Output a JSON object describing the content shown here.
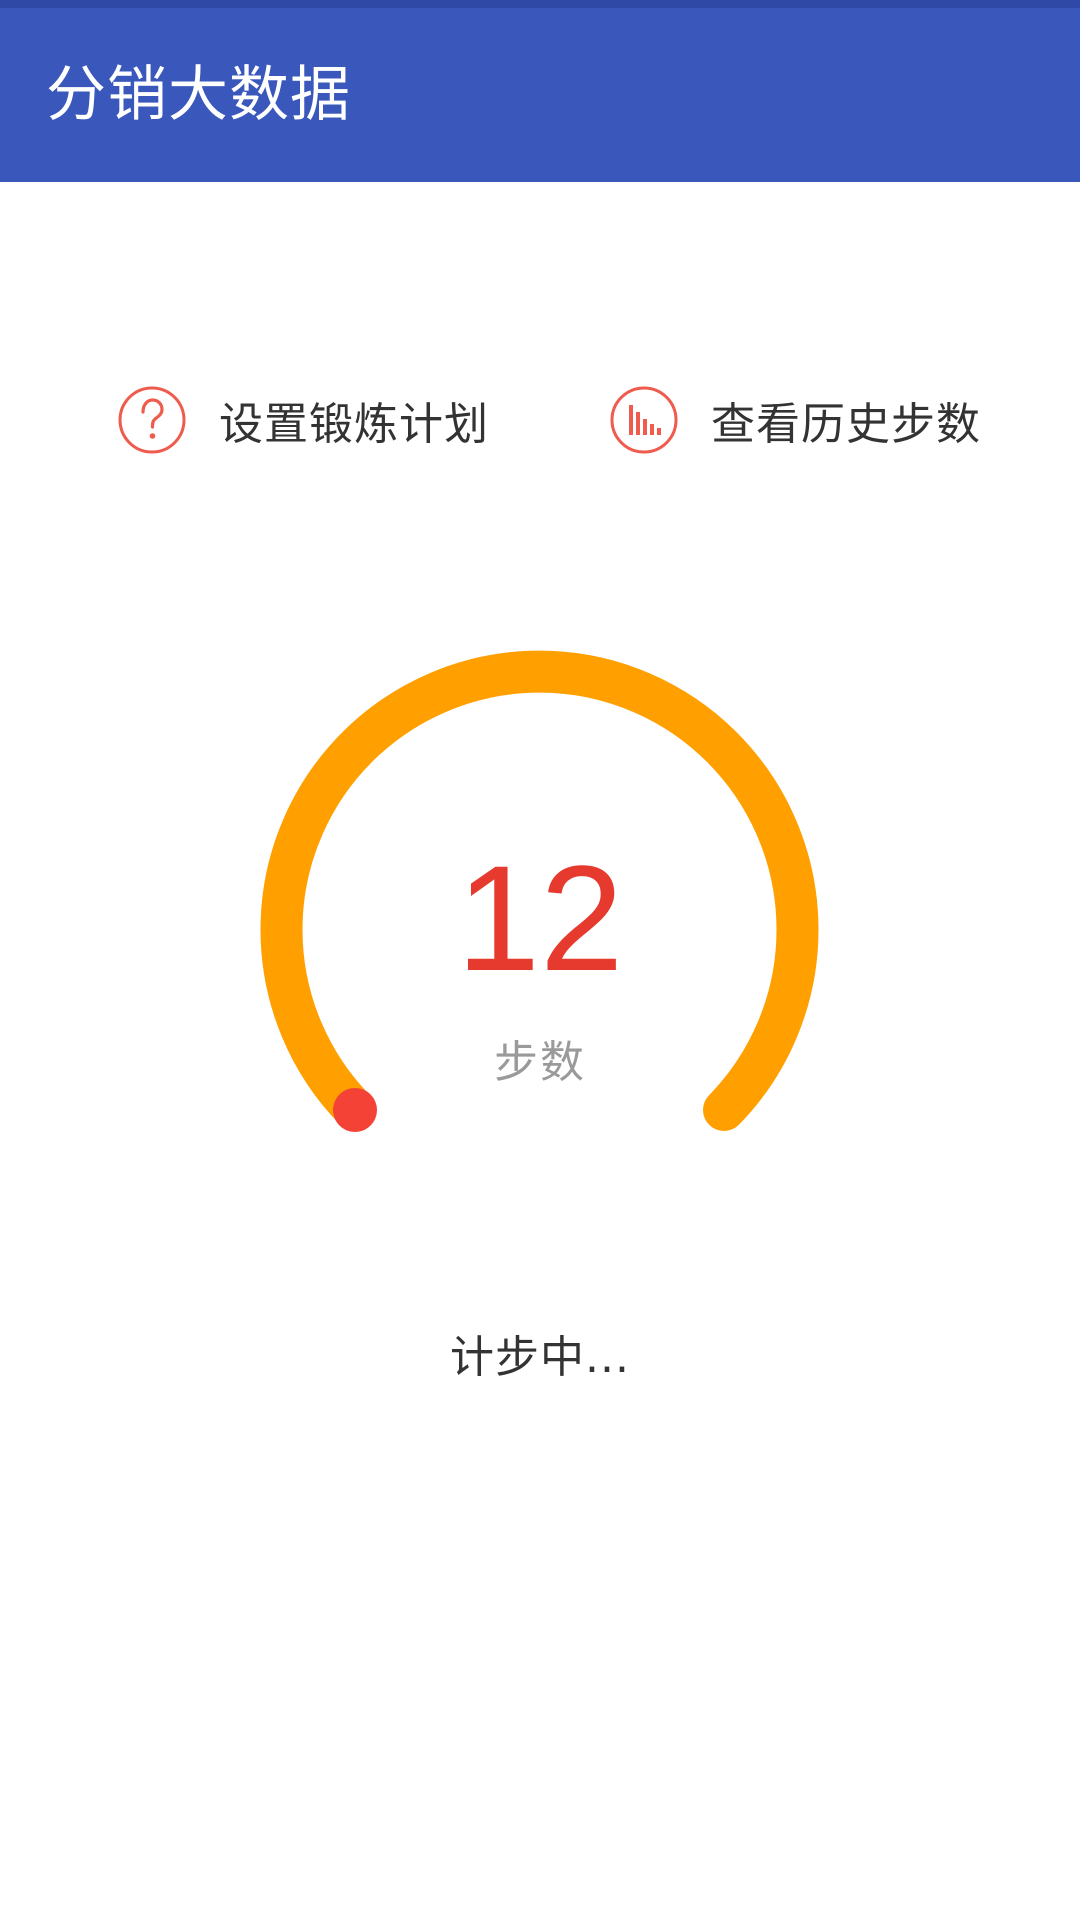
{
  "app_bar": {
    "title": "分销大数据",
    "background_color": "#3a58bb"
  },
  "actions": {
    "plan": {
      "label": "设置锻炼计划",
      "icon": "question-circle-icon"
    },
    "history": {
      "label": "查看历史步数",
      "icon": "bar-chart-circle-icon"
    }
  },
  "pedometer": {
    "count": "12",
    "unit": "步数",
    "progress": 0.0,
    "arc_color": "#ff9f00",
    "indicator_color": "#f44336",
    "count_color": "#e63a2e"
  },
  "status": {
    "text": "计步中..."
  }
}
